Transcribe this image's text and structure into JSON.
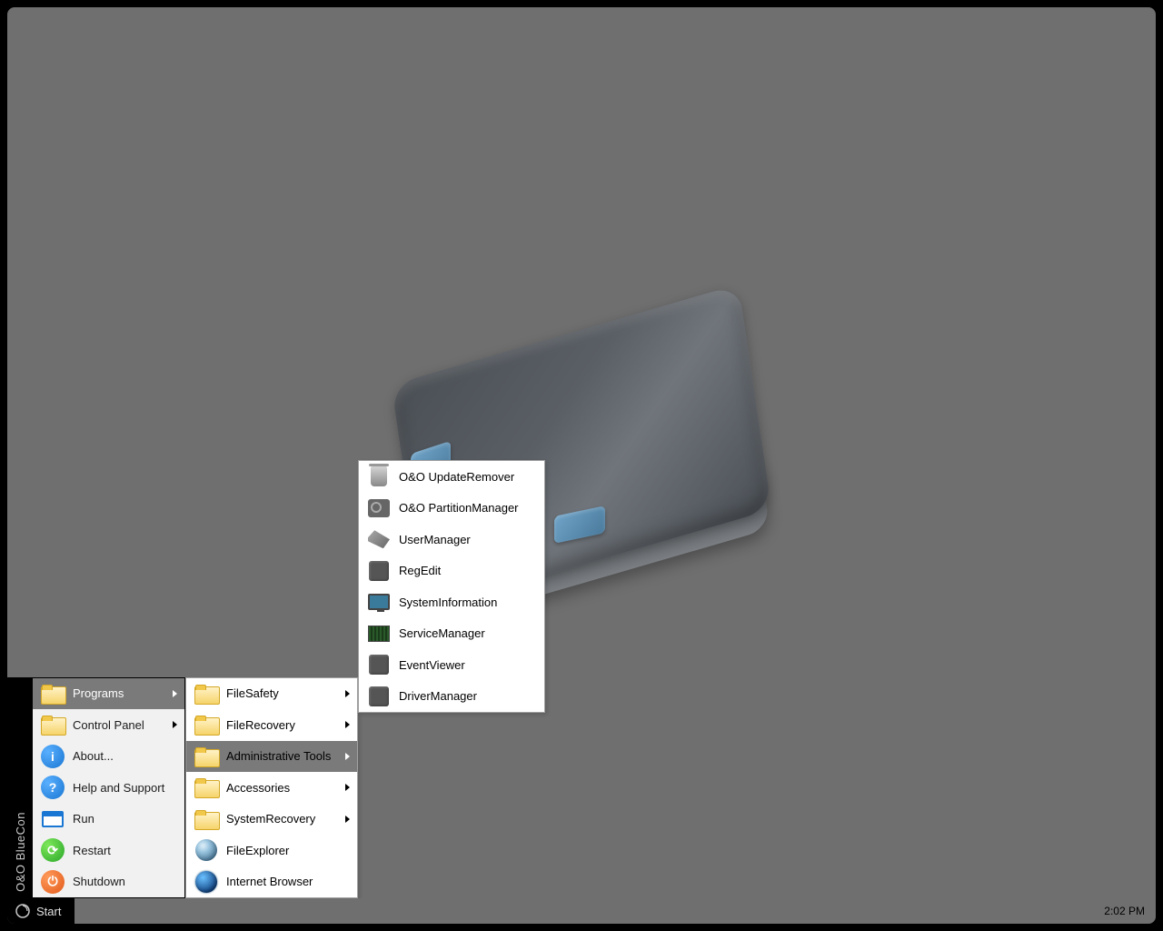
{
  "sidebar_label": "O&O BlueCon",
  "taskbar": {
    "start": "Start",
    "clock": "2:02 PM"
  },
  "start_menu": [
    {
      "label": "Programs",
      "icon": "folder",
      "arrow": true,
      "selected": true
    },
    {
      "label": "Control Panel",
      "icon": "folder",
      "arrow": true
    },
    {
      "label": "About...",
      "icon": "info"
    },
    {
      "label": "Help and Support",
      "icon": "help"
    },
    {
      "label": "Run",
      "icon": "window"
    },
    {
      "label": "Restart",
      "icon": "restart"
    },
    {
      "label": "Shutdown",
      "icon": "shutdown"
    }
  ],
  "programs_menu": [
    {
      "label": "FileSafety",
      "icon": "folder",
      "arrow": true
    },
    {
      "label": "FileRecovery",
      "icon": "folder",
      "arrow": true
    },
    {
      "label": "Administrative Tools",
      "icon": "folder",
      "arrow": true,
      "selected": true
    },
    {
      "label": "Accessories",
      "icon": "folder",
      "arrow": true
    },
    {
      "label": "SystemRecovery",
      "icon": "folder",
      "arrow": true
    },
    {
      "label": "FileExplorer",
      "icon": "globe-grey"
    },
    {
      "label": "Internet Browser",
      "icon": "globe-blue"
    }
  ],
  "admin_tools_menu": [
    {
      "label": "O&O UpdateRemover",
      "icon": "trash"
    },
    {
      "label": "O&O PartitionManager",
      "icon": "disk"
    },
    {
      "label": "UserManager",
      "icon": "keys"
    },
    {
      "label": "RegEdit",
      "icon": "block"
    },
    {
      "label": "SystemInformation",
      "icon": "monitor"
    },
    {
      "label": "ServiceManager",
      "icon": "chip"
    },
    {
      "label": "EventViewer",
      "icon": "block"
    },
    {
      "label": "DriverManager",
      "icon": "block"
    }
  ]
}
